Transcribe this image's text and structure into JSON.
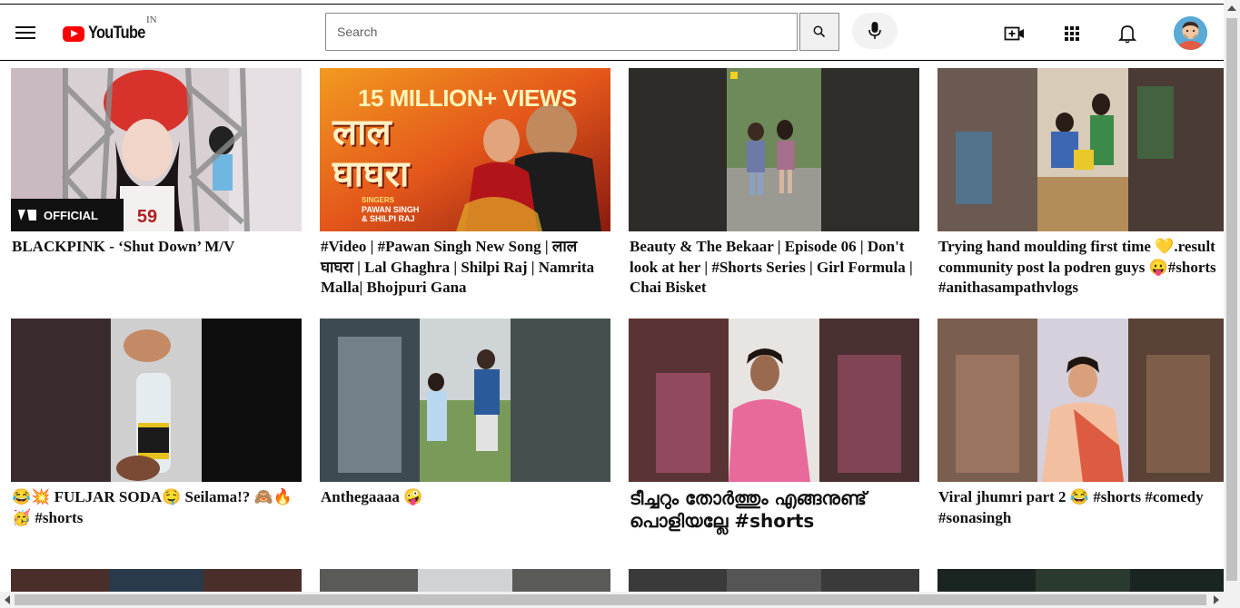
{
  "header": {
    "logo_text": "YouTube",
    "country": "IN",
    "search_placeholder": "Search",
    "search_value": ""
  },
  "icons": {
    "menu": "hamburger-menu-icon",
    "search": "search-icon",
    "mic": "microphone-icon",
    "create": "create-video-icon",
    "apps": "apps-grid-icon",
    "notifications": "bell-icon",
    "avatar": "user-avatar"
  },
  "colors": {
    "brand_red": "#ff0000",
    "text": "#0f0f0f",
    "scrollbar": "#c1c1c1"
  },
  "videos": [
    {
      "title": "BLACKPINK - ‘Shut Down’ M/V",
      "badge": "OFFICIAL"
    },
    {
      "title": "#Video | #Pawan Singh New Song | लाल घाघरा | Lal Ghaghra | Shilpi Raj | Namrita Malla| Bhojpuri Gana",
      "thumb_text_views": "15 MILLION+ VIEWS",
      "thumb_text_song": "लाल घाघरा",
      "thumb_text_singers_label": "SINGERS",
      "thumb_text_singers": "PAWAN SINGH & SHILPI RAJ"
    },
    {
      "title": "Beauty & The Bekaar | Episode 06 | Don't look at her | #Shorts Series | Girl Formula | Chai Bisket"
    },
    {
      "title": "Trying hand moulding first time 💛.result community post la podren guys 😛#shorts #anithasampathvlogs"
    },
    {
      "title": "😂💥 FULJAR SODA🤤 Seilama!? 🙈🔥 🥳 #shorts"
    },
    {
      "title": "Anthegaaaa 🤪"
    },
    {
      "title": "ടീച്ചറും തോർത്തും എങ്ങനുണ്ട് പൊളിയല്ലേ #shorts"
    },
    {
      "title": "Viral jhumri part 2 😂 #shorts #comedy #sonasingh"
    }
  ]
}
